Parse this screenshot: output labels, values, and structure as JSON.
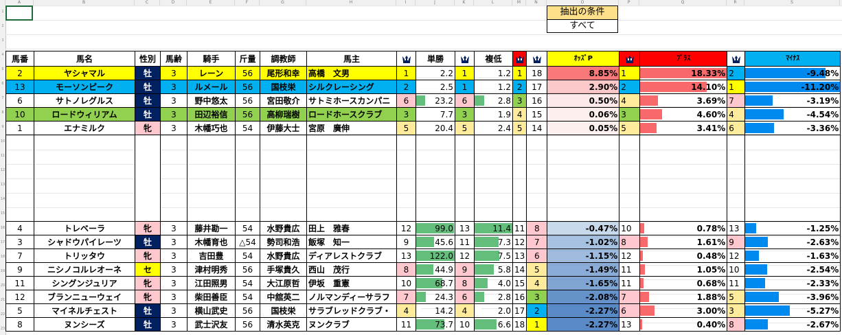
{
  "condition": {
    "title": "抽出の条件",
    "value": "すべて"
  },
  "headers": {
    "num": "馬番",
    "name": "馬名",
    "sex": "性別",
    "age": "馬齢",
    "jockey": "騎手",
    "weight": "斤量",
    "trainer": "調教師",
    "owner": "馬主",
    "win": "単勝",
    "place": "複低",
    "oddsP": "ｵｯｽﾞP",
    "plus": "ﾌﾟﾗｽ",
    "minus": "ﾏｲﾅｽ"
  },
  "colors": {
    "yellow": "#ffff00",
    "blue": "#00b0f0",
    "green": "#92d050",
    "male": "#002060",
    "female": "#ffc7ce",
    "pinkRank": "#ffc7ce",
    "orangeRank": "#ffeb9c",
    "barGreen": "#63be7b",
    "barRed": "#f8696b",
    "barBlue": "#008aef",
    "crownRed": "#ff0000"
  },
  "rows": [
    {
      "num": "2",
      "name": "ヤシャマル",
      "sex": "牡",
      "age": "3",
      "jockey": "レーン",
      "weight": "56",
      "trainer": "尾形和幸",
      "owner": "高橋　文男",
      "winRank": "1",
      "win": "2.2",
      "placeRank": "1",
      "place": "1.2",
      "rankA": "1",
      "rankB": "18",
      "oddsP": "8.85%",
      "plusRank": "1",
      "plus": "18.33%",
      "minusRank": "2",
      "minus": "-9.48%",
      "hl": "yellow"
    },
    {
      "num": "13",
      "name": "モーソンピーク",
      "sex": "牡",
      "age": "3",
      "jockey": "ルメール",
      "weight": "56",
      "trainer": "国枝栄",
      "owner": "シルクレーシング",
      "winRank": "2",
      "win": "2.5",
      "placeRank": "1",
      "place": "1.2",
      "rankA": "2",
      "rankB": "17",
      "oddsP": "2.90%",
      "plusRank": "2",
      "plus": "14.10%",
      "minusRank": "1",
      "minus": "-11.20%",
      "hl": "blue"
    },
    {
      "num": "6",
      "name": "サトノレグルス",
      "sex": "牡",
      "age": "3",
      "jockey": "野中悠太",
      "weight": "56",
      "trainer": "宮田敬介",
      "owner": "サトミホースカンパニ",
      "winRank": "6",
      "win": "23.2",
      "placeRank": "6",
      "place": "2.8",
      "rankA": "3",
      "rankB": "16",
      "oddsP": "0.50%",
      "plusRank": "4",
      "plus": "3.69%",
      "minusRank": "7",
      "minus": "-3.19%",
      "hl": ""
    },
    {
      "num": "10",
      "name": "ロードウィリアム",
      "sex": "牡",
      "age": "3",
      "jockey": "田辺裕信",
      "weight": "56",
      "trainer": "高柳瑞樹",
      "owner": "ロードホースクラブ",
      "winRank": "3",
      "win": "7.7",
      "placeRank": "3",
      "place": "1.9",
      "rankA": "4",
      "rankB": "15",
      "oddsP": "0.06%",
      "plusRank": "3",
      "plus": "4.60%",
      "minusRank": "4",
      "minus": "-4.54%",
      "hl": "green"
    },
    {
      "num": "1",
      "name": "エナミルク",
      "sex": "牝",
      "age": "3",
      "jockey": "木幡巧也",
      "weight": "54",
      "trainer": "伊藤大士",
      "owner": "宮原　廣伸",
      "winRank": "5",
      "win": "20.4",
      "placeRank": "5",
      "place": "2.4",
      "rankA": "5",
      "rankB": "14",
      "oddsP": "0.05%",
      "plusRank": "5",
      "plus": "3.41%",
      "minusRank": "6",
      "minus": "-3.36%",
      "hl": ""
    }
  ],
  "rows2": [
    {
      "num": "4",
      "name": "トレベーラ",
      "sex": "牝",
      "age": "3",
      "jockey": "藤井勘一",
      "weight": "54",
      "trainer": "水野貴広",
      "owner": "田上　雅春",
      "winRank": "12",
      "win": "99.0",
      "placeRank": "13",
      "place": "11.4",
      "rankA": "11",
      "rankB": "8",
      "oddsP": "-0.47%",
      "plusRank": "10",
      "plus": "0.78%",
      "minusRank": "13",
      "minus": "-1.25%"
    },
    {
      "num": "3",
      "name": "シャドウパイレーツ",
      "sex": "牡",
      "age": "3",
      "jockey": "木幡育也",
      "weight": "△54",
      "trainer": "勢司和浩",
      "owner": "飯塚　知一",
      "winRank": "9",
      "win": "45.6",
      "placeRank": "11",
      "place": "7.3",
      "rankA": "12",
      "rankB": "7",
      "oddsP": "-1.02%",
      "plusRank": "8",
      "plus": "1.61%",
      "minusRank": "9",
      "minus": "-2.63%"
    },
    {
      "num": "7",
      "name": "トリッタウ",
      "sex": "牝",
      "age": "3",
      "jockey": "吉田豊",
      "weight": "54",
      "trainer": "水野貴広",
      "owner": "ディアレストクラブ",
      "winRank": "13",
      "win": "122.0",
      "placeRank": "12",
      "place": "7.5",
      "rankA": "13",
      "rankB": "6",
      "oddsP": "-1.15%",
      "plusRank": "12",
      "plus": "0.48%",
      "minusRank": "12",
      "minus": "-1.63%"
    },
    {
      "num": "9",
      "name": "ニシノコルレオーネ",
      "sex": "セ",
      "age": "3",
      "jockey": "津村明秀",
      "weight": "56",
      "trainer": "手塚貴久",
      "owner": "西山　茂行",
      "winRank": "8",
      "win": "44.9",
      "placeRank": "9",
      "place": "5.8",
      "rankA": "14",
      "rankB": "5",
      "oddsP": "-1.49%",
      "plusRank": "11",
      "plus": "1.05%",
      "minusRank": "10",
      "minus": "-2.54%"
    },
    {
      "num": "11",
      "name": "シングンジュリア",
      "sex": "牝",
      "age": "3",
      "jockey": "江田照男",
      "weight": "54",
      "trainer": "大江原哲",
      "owner": "伊坂　重憲",
      "winRank": "10",
      "win": "68.7",
      "placeRank": "8",
      "place": "4.0",
      "rankA": "15",
      "rankB": "4",
      "oddsP": "-1.65%",
      "plusRank": "11",
      "plus": "0.68%",
      "minusRank": "11",
      "minus": "-2.33%"
    },
    {
      "num": "12",
      "name": "ブランニューウェイ",
      "sex": "牝",
      "age": "3",
      "jockey": "柴田善臣",
      "weight": "54",
      "trainer": "中舘英二",
      "owner": "ノルマンディーサラフ",
      "winRank": "7",
      "win": "24.3",
      "placeRank": "6",
      "place": "2.8",
      "rankA": "16",
      "rankB": "3",
      "oddsP": "-2.08%",
      "plusRank": "7",
      "plus": "1.88%",
      "minusRank": "5",
      "minus": "-3.96%"
    },
    {
      "num": "5",
      "name": "マイネルチェスト",
      "sex": "牡",
      "age": "3",
      "jockey": "横山武史",
      "weight": "56",
      "trainer": "国枝栄",
      "owner": "サラブレッドクラブ・",
      "winRank": "4",
      "win": "14.2",
      "placeRank": "4",
      "place": "2.0",
      "rankA": "17",
      "rankB": "2",
      "oddsP": "-2.27%",
      "plusRank": "6",
      "plus": "3.00%",
      "minusRank": "3",
      "minus": "-5.27%"
    },
    {
      "num": "8",
      "name": "ヌンシーズ",
      "sex": "牡",
      "age": "3",
      "jockey": "武士沢友",
      "weight": "56",
      "trainer": "清水英克",
      "owner": "ヌンクラブ",
      "winRank": "11",
      "win": "73.7",
      "placeRank": "10",
      "place": "6.6",
      "rankA": "18",
      "rankB": "1",
      "oddsP": "-2.27%",
      "plusRank": "13",
      "plus": "0.40%",
      "minusRank": "8",
      "minus": "-2.67%"
    }
  ]
}
